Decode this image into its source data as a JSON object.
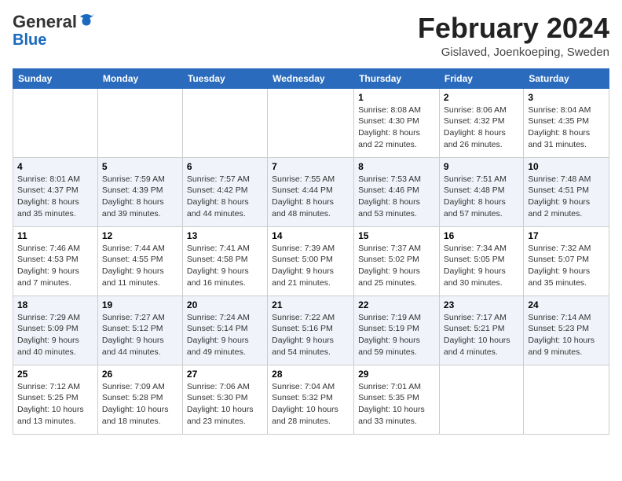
{
  "header": {
    "logo_line1": "General",
    "logo_line2": "Blue",
    "month": "February 2024",
    "location": "Gislaved, Joenkoeping, Sweden"
  },
  "weekdays": [
    "Sunday",
    "Monday",
    "Tuesday",
    "Wednesday",
    "Thursday",
    "Friday",
    "Saturday"
  ],
  "weeks": [
    [
      {
        "day": "",
        "info": ""
      },
      {
        "day": "",
        "info": ""
      },
      {
        "day": "",
        "info": ""
      },
      {
        "day": "",
        "info": ""
      },
      {
        "day": "1",
        "info": "Sunrise: 8:08 AM\nSunset: 4:30 PM\nDaylight: 8 hours\nand 22 minutes."
      },
      {
        "day": "2",
        "info": "Sunrise: 8:06 AM\nSunset: 4:32 PM\nDaylight: 8 hours\nand 26 minutes."
      },
      {
        "day": "3",
        "info": "Sunrise: 8:04 AM\nSunset: 4:35 PM\nDaylight: 8 hours\nand 31 minutes."
      }
    ],
    [
      {
        "day": "4",
        "info": "Sunrise: 8:01 AM\nSunset: 4:37 PM\nDaylight: 8 hours\nand 35 minutes."
      },
      {
        "day": "5",
        "info": "Sunrise: 7:59 AM\nSunset: 4:39 PM\nDaylight: 8 hours\nand 39 minutes."
      },
      {
        "day": "6",
        "info": "Sunrise: 7:57 AM\nSunset: 4:42 PM\nDaylight: 8 hours\nand 44 minutes."
      },
      {
        "day": "7",
        "info": "Sunrise: 7:55 AM\nSunset: 4:44 PM\nDaylight: 8 hours\nand 48 minutes."
      },
      {
        "day": "8",
        "info": "Sunrise: 7:53 AM\nSunset: 4:46 PM\nDaylight: 8 hours\nand 53 minutes."
      },
      {
        "day": "9",
        "info": "Sunrise: 7:51 AM\nSunset: 4:48 PM\nDaylight: 8 hours\nand 57 minutes."
      },
      {
        "day": "10",
        "info": "Sunrise: 7:48 AM\nSunset: 4:51 PM\nDaylight: 9 hours\nand 2 minutes."
      }
    ],
    [
      {
        "day": "11",
        "info": "Sunrise: 7:46 AM\nSunset: 4:53 PM\nDaylight: 9 hours\nand 7 minutes."
      },
      {
        "day": "12",
        "info": "Sunrise: 7:44 AM\nSunset: 4:55 PM\nDaylight: 9 hours\nand 11 minutes."
      },
      {
        "day": "13",
        "info": "Sunrise: 7:41 AM\nSunset: 4:58 PM\nDaylight: 9 hours\nand 16 minutes."
      },
      {
        "day": "14",
        "info": "Sunrise: 7:39 AM\nSunset: 5:00 PM\nDaylight: 9 hours\nand 21 minutes."
      },
      {
        "day": "15",
        "info": "Sunrise: 7:37 AM\nSunset: 5:02 PM\nDaylight: 9 hours\nand 25 minutes."
      },
      {
        "day": "16",
        "info": "Sunrise: 7:34 AM\nSunset: 5:05 PM\nDaylight: 9 hours\nand 30 minutes."
      },
      {
        "day": "17",
        "info": "Sunrise: 7:32 AM\nSunset: 5:07 PM\nDaylight: 9 hours\nand 35 minutes."
      }
    ],
    [
      {
        "day": "18",
        "info": "Sunrise: 7:29 AM\nSunset: 5:09 PM\nDaylight: 9 hours\nand 40 minutes."
      },
      {
        "day": "19",
        "info": "Sunrise: 7:27 AM\nSunset: 5:12 PM\nDaylight: 9 hours\nand 44 minutes."
      },
      {
        "day": "20",
        "info": "Sunrise: 7:24 AM\nSunset: 5:14 PM\nDaylight: 9 hours\nand 49 minutes."
      },
      {
        "day": "21",
        "info": "Sunrise: 7:22 AM\nSunset: 5:16 PM\nDaylight: 9 hours\nand 54 minutes."
      },
      {
        "day": "22",
        "info": "Sunrise: 7:19 AM\nSunset: 5:19 PM\nDaylight: 9 hours\nand 59 minutes."
      },
      {
        "day": "23",
        "info": "Sunrise: 7:17 AM\nSunset: 5:21 PM\nDaylight: 10 hours\nand 4 minutes."
      },
      {
        "day": "24",
        "info": "Sunrise: 7:14 AM\nSunset: 5:23 PM\nDaylight: 10 hours\nand 9 minutes."
      }
    ],
    [
      {
        "day": "25",
        "info": "Sunrise: 7:12 AM\nSunset: 5:25 PM\nDaylight: 10 hours\nand 13 minutes."
      },
      {
        "day": "26",
        "info": "Sunrise: 7:09 AM\nSunset: 5:28 PM\nDaylight: 10 hours\nand 18 minutes."
      },
      {
        "day": "27",
        "info": "Sunrise: 7:06 AM\nSunset: 5:30 PM\nDaylight: 10 hours\nand 23 minutes."
      },
      {
        "day": "28",
        "info": "Sunrise: 7:04 AM\nSunset: 5:32 PM\nDaylight: 10 hours\nand 28 minutes."
      },
      {
        "day": "29",
        "info": "Sunrise: 7:01 AM\nSunset: 5:35 PM\nDaylight: 10 hours\nand 33 minutes."
      },
      {
        "day": "",
        "info": ""
      },
      {
        "day": "",
        "info": ""
      }
    ]
  ]
}
